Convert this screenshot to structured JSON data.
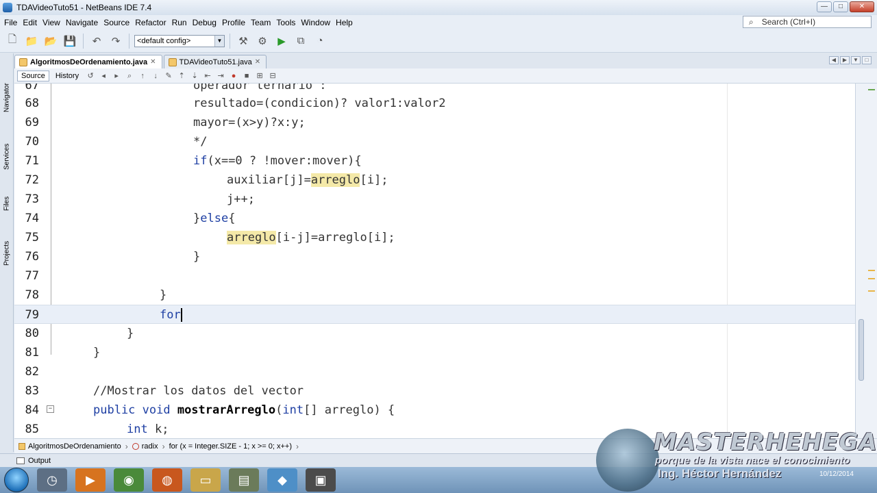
{
  "window": {
    "title": "TDAVideoTuto51 - NetBeans IDE 7.4",
    "controls": [
      "—",
      "□",
      "✕"
    ]
  },
  "menu": [
    "File",
    "Edit",
    "View",
    "Navigate",
    "Source",
    "Refactor",
    "Run",
    "Debug",
    "Profile",
    "Team",
    "Tools",
    "Window",
    "Help"
  ],
  "search": {
    "placeholder": "Search (Ctrl+I)"
  },
  "toolbar": {
    "config": "<default config>"
  },
  "side_tabs": [
    "Navigator",
    "Services",
    "Files",
    "Projects"
  ],
  "tabs": [
    {
      "label": "AlgoritmosDeOrdenamiento.java",
      "active": true
    },
    {
      "label": "TDAVideoTuto51.java",
      "active": false
    }
  ],
  "editor_toolbar": {
    "source": "Source",
    "history": "History"
  },
  "code_lines": [
    {
      "n": "67",
      "text": "operador ternario :"
    },
    {
      "n": "68",
      "text": "resultado=(condicion)? valor1:valor2"
    },
    {
      "n": "69",
      "text": "mayor=(x>y)?x:y;"
    },
    {
      "n": "70",
      "text": "*/"
    },
    {
      "n": "71",
      "kw": "if",
      "text": "(x==0 ? !mover:mover){"
    },
    {
      "n": "72",
      "pre": "auxiliar[j]=",
      "hl": "arreglo",
      "post": "[i];"
    },
    {
      "n": "73",
      "text": "j++;"
    },
    {
      "n": "74",
      "pre": "}",
      "kw": "else",
      "post": "{"
    },
    {
      "n": "75",
      "hl": "arreglo",
      "post": "[i-j]=arreglo[i];"
    },
    {
      "n": "76",
      "text": "}"
    },
    {
      "n": "77",
      "text": ""
    },
    {
      "n": "78",
      "text": "}"
    },
    {
      "n": "79",
      "kw": "for"
    },
    {
      "n": "80",
      "text": "}"
    },
    {
      "n": "81",
      "text": "}"
    },
    {
      "n": "82",
      "text": ""
    },
    {
      "n": "83",
      "text": "//Mostrar los datos del vector"
    },
    {
      "n": "84",
      "kw": "public void ",
      "bold": "mostrarArreglo",
      "pre2": "(",
      "kw2": "int",
      "post": "[] arreglo) {"
    },
    {
      "n": "85",
      "kw": "int",
      "post": " k;"
    }
  ],
  "breadcrumb": [
    "AlgoritmosDeOrdenamiento",
    "radix",
    "for (x = Integer.SIZE - 1; x >= 0; x++)"
  ],
  "output": {
    "label": "Output"
  },
  "taskbar": {
    "date": "10/12/2014"
  },
  "watermark": {
    "brand": "MASTERHEHEGAR",
    "tagline": "porque de la vista nace el conocimiento",
    "author": "Ing. Héctor Hernández"
  }
}
